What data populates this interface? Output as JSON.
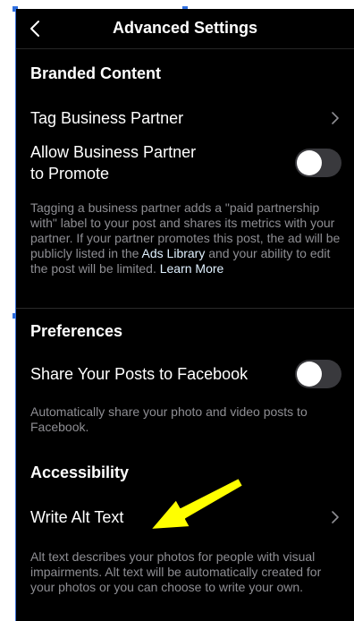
{
  "nav": {
    "title": "Advanced Settings"
  },
  "branded": {
    "header": "Branded Content",
    "tag_label": "Tag Business Partner",
    "allow_label_1": "Allow Business Partner",
    "allow_label_2": "to Promote",
    "allow_on": false,
    "desc_before": "Tagging a business partner adds a \"paid partnership with\" label to your post and shares its metrics with your partner. If your partner promotes this post, the ad will be publicly listed in the ",
    "ads_library": "Ads Library",
    "desc_middle": " and your ability to edit the post will be limited. ",
    "learn_more": "Learn More"
  },
  "preferences": {
    "header": "Preferences",
    "share_label": "Share Your Posts to Facebook",
    "share_on": false,
    "share_desc": "Automatically share your photo and video posts to Facebook."
  },
  "accessibility": {
    "header": "Accessibility",
    "alt_label": "Write Alt Text",
    "alt_desc": "Alt text describes your photos for people with visual impairments. Alt text will be automatically created for your photos or you can choose to write your own."
  },
  "colors": {
    "background": "#000000",
    "toggle_off": "#39393d",
    "annotation_arrow": "#ffff00",
    "selection_handle": "#2f6fe0"
  }
}
